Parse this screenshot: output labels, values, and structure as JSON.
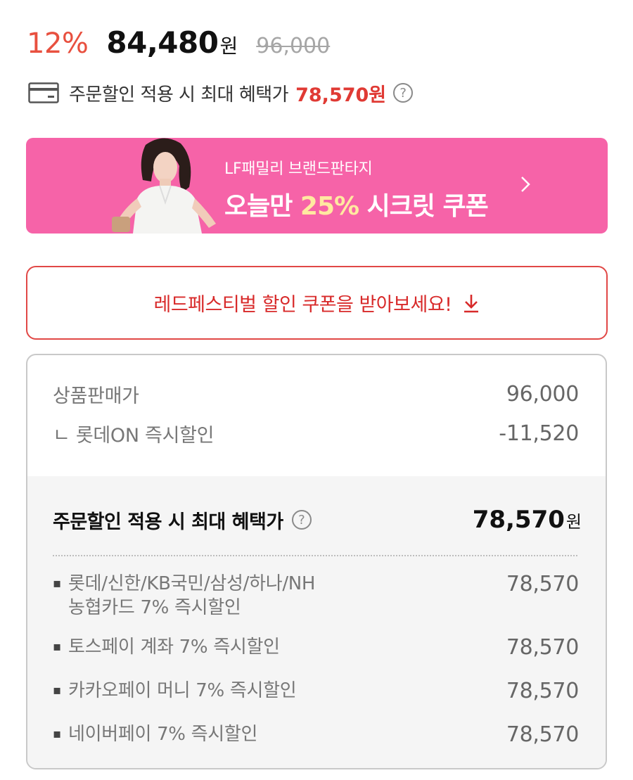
{
  "price": {
    "discount_rate": "12%",
    "sale_price": "84,480",
    "sale_unit": "원",
    "original_price": "96,000"
  },
  "benefit": {
    "card_icon": "credit-card-icon",
    "label": "주문할인 적용 시 최대 혜택가",
    "price": "78,570원",
    "help_icon": "question-circle-icon"
  },
  "banner": {
    "subtitle": "LF패밀리 브랜드판타지",
    "title_prefix": "오늘만 ",
    "title_highlight": "25%",
    "title_suffix": " 시크릿 쿠폰",
    "chevron_icon": "chevron-right-icon",
    "background_color": "#f663a8"
  },
  "festival_button": {
    "label": "레드페스티벌 할인 쿠폰을 받아보세요!",
    "icon": "download-arrow-icon",
    "color": "#d82a2a"
  },
  "breakdown": {
    "rows": [
      {
        "label": "상품판매가",
        "value": "96,000"
      },
      {
        "label": "ㄴ 롯데ON 즉시할인",
        "value": "-11,520"
      }
    ],
    "max_benefit_label": "주문할인 적용 시 최대 혜택가",
    "max_benefit_price": "78,570",
    "max_benefit_unit": "원",
    "payment_discounts": [
      {
        "line1": "롯데/신한/KB국민/삼성/하나/NH",
        "line2": "농협카드 7% 즉시할인",
        "value": "78,570"
      },
      {
        "line1": "토스페이 계좌 7% 즉시할인",
        "line2": "",
        "value": "78,570"
      },
      {
        "line1": "카카오페이 머니 7% 즉시할인",
        "line2": "",
        "value": "78,570"
      },
      {
        "line1": "네이버페이 7% 즉시할인",
        "line2": "",
        "value": "78,570"
      }
    ]
  }
}
